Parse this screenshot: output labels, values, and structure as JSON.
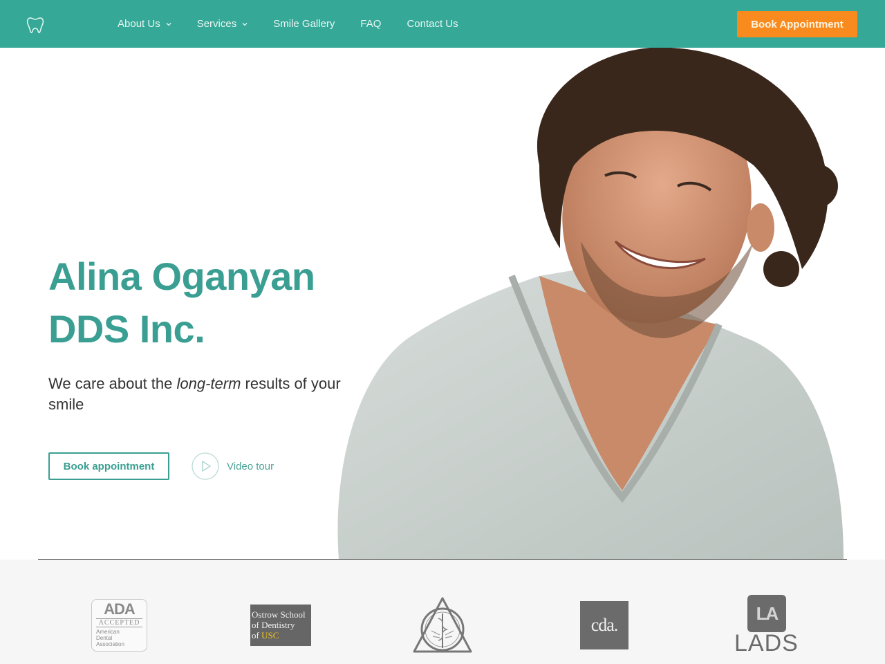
{
  "nav": {
    "logo_icon": "tooth-icon",
    "items": [
      {
        "label": "About Us",
        "has_dropdown": true
      },
      {
        "label": "Services",
        "has_dropdown": true
      },
      {
        "label": "Smile Gallery",
        "has_dropdown": false
      },
      {
        "label": "FAQ",
        "has_dropdown": false
      },
      {
        "label": "Contact Us",
        "has_dropdown": false
      }
    ],
    "cta_label": "Book Appointment"
  },
  "hero": {
    "title_line1": "Alina Oganyan",
    "title_line2": "DDS Inc.",
    "tagline_before": "We care about the ",
    "tagline_emphasis": "long-term",
    "tagline_after": " results of your smile",
    "book_label": "Book appointment",
    "video_label": "Video tour",
    "image_alt": "Smiling man with curly hair in a light gray sweater"
  },
  "colors": {
    "brand_teal": "#36a897",
    "heading_teal": "#3a9f92",
    "cta_orange": "#f98a1d",
    "logo_gray": "#6b6b6b"
  },
  "affiliations": [
    {
      "name": "ADA",
      "line1": "ADA",
      "line2": "ACCEPTED",
      "line3": "American",
      "line4": "Dental",
      "line5": "Association"
    },
    {
      "name": "Ostrow School of Dentistry of USC",
      "line1": "Ostrow School",
      "line2": "of Dentistry",
      "line3": "of ",
      "line4": "USC"
    },
    {
      "name": "American College of Dentists",
      "emblem": "caduceus-triangle-emblem"
    },
    {
      "name": "CDA",
      "line1": "cda."
    },
    {
      "name": "LADS",
      "line1": "LA",
      "line2": "LADS"
    }
  ]
}
